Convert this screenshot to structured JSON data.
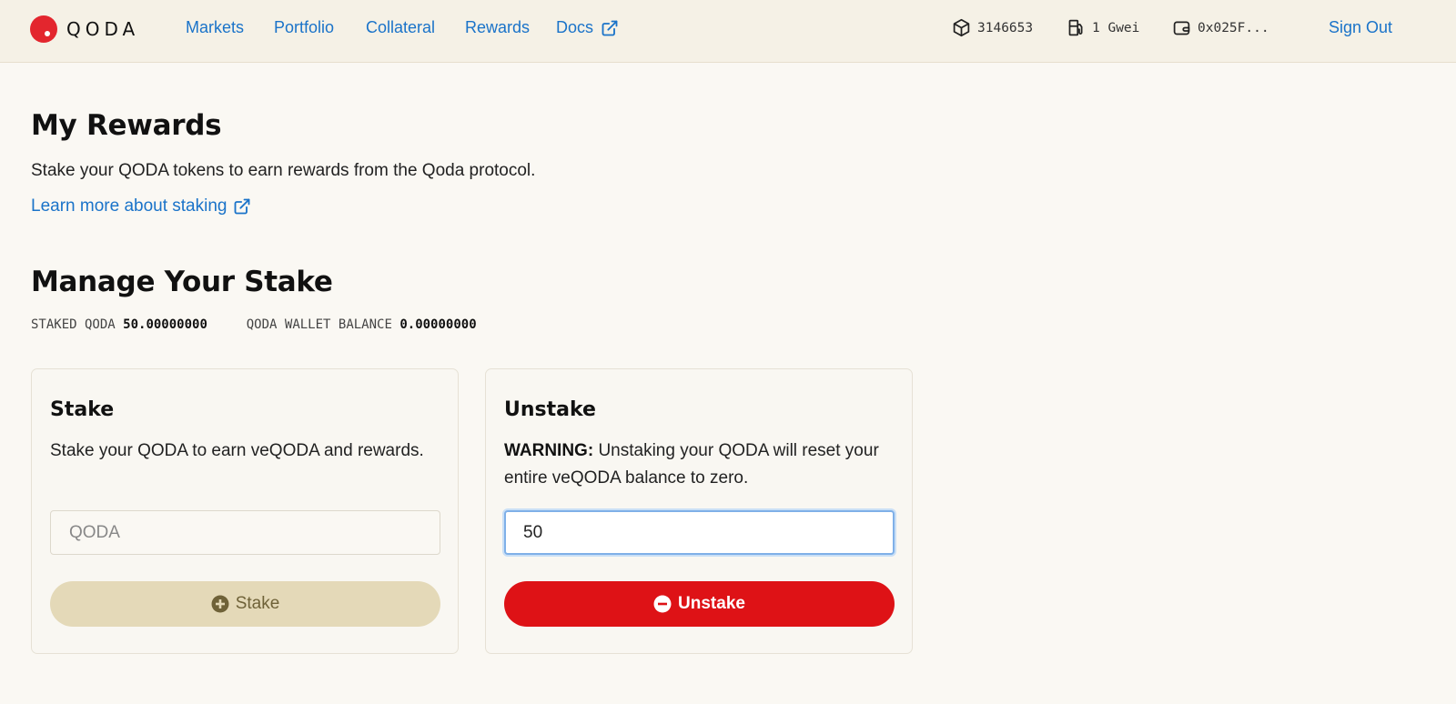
{
  "header": {
    "logo_text": "QODA",
    "nav": [
      {
        "label": "Markets"
      },
      {
        "label": "Portfolio"
      },
      {
        "label": "Collateral"
      },
      {
        "label": "Rewards"
      },
      {
        "label": "Docs"
      }
    ],
    "block_number": "3146653",
    "gas_price": "1 Gwei",
    "wallet_address": "0x025F...",
    "sign_out_label": "Sign Out"
  },
  "rewards": {
    "title": "My Rewards",
    "description": "Stake your QODA tokens to earn rewards from the Qoda protocol.",
    "learn_more_label": "Learn more about staking"
  },
  "manage": {
    "title": "Manage Your Stake",
    "staked_label": "STAKED QODA",
    "staked_value": "50.00000000",
    "wallet_label": "QODA WALLET BALANCE",
    "wallet_value": "0.00000000"
  },
  "stake_card": {
    "title": "Stake",
    "description": "Stake your QODA to earn veQODA and rewards.",
    "input_placeholder": "QODA",
    "input_value": "",
    "button_label": "Stake"
  },
  "unstake_card": {
    "title": "Unstake",
    "warning_label": "WARNING:",
    "description": "Unstaking your QODA will reset your entire veQODA balance to zero.",
    "input_placeholder": "QODA",
    "input_value": "50",
    "button_label": "Unstake"
  },
  "colors": {
    "accent": "#1a73c9",
    "brand_red": "#e3262e",
    "unstake_button": "#de1216",
    "stake_button": "#e4d9b8",
    "background": "#faf8f3"
  },
  "icons": {
    "logo": "qoda-logo-icon",
    "external_link": "external-link-icon",
    "block": "cube-icon",
    "gas": "gas-pump-icon",
    "wallet": "wallet-icon",
    "stake": "plus-circle-icon",
    "unstake": "minus-circle-icon"
  }
}
